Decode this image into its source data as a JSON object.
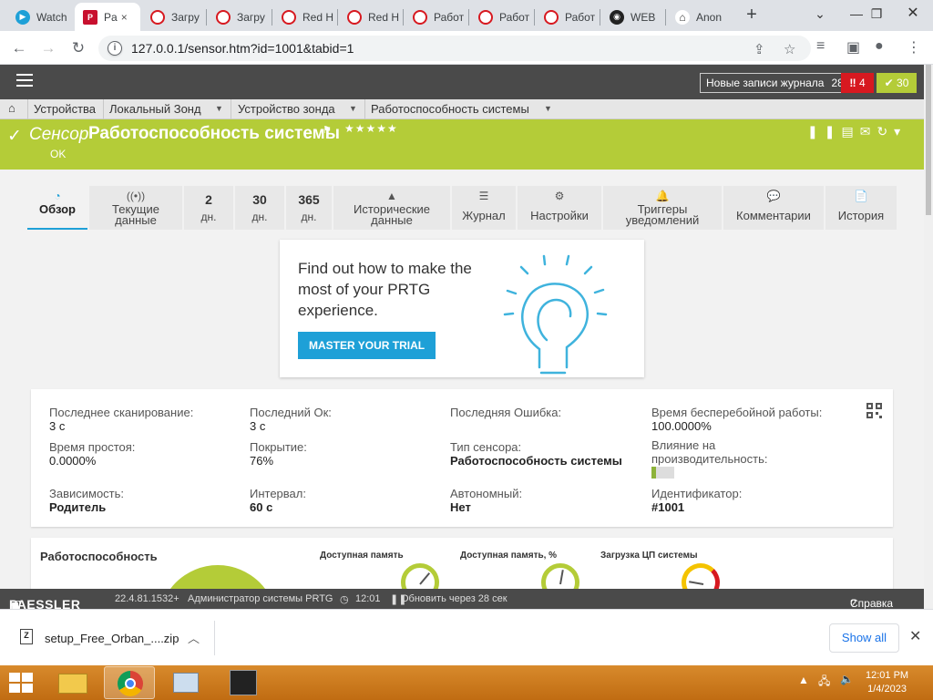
{
  "browser": {
    "tabs": [
      {
        "label": "Watch",
        "fav_color": "#1ea0d7",
        "active": false
      },
      {
        "label": "Pa",
        "fav_color": "#c8102e",
        "active": true
      },
      {
        "label": "Загру",
        "fav_color": "#d71920",
        "active": false
      },
      {
        "label": "Загру",
        "fav_color": "#d71920",
        "active": false
      },
      {
        "label": "Red H",
        "fav_color": "#d71920",
        "active": false
      },
      {
        "label": "Red H",
        "fav_color": "#d71920",
        "active": false
      },
      {
        "label": "Работ",
        "fav_color": "#d71920",
        "active": false
      },
      {
        "label": "Работ",
        "fav_color": "#d71920",
        "active": false
      },
      {
        "label": "Работ",
        "fav_color": "#d71920",
        "active": false
      },
      {
        "label": "WEB",
        "fav_color": "#222222",
        "active": false
      },
      {
        "label": "Anon",
        "fav_color": "#555555",
        "active": false
      }
    ],
    "active_tab_close": "×",
    "new_tab": "+",
    "url": "127.0.0.1/sensor.htm?id=1001&tabid=1"
  },
  "prtg": {
    "log_button": "Новые записи журнала",
    "log_count": "28",
    "alarms": "4",
    "ok_count": "30",
    "breadcrumb": [
      "Устройства",
      "Локальный Зонд",
      "Устройство зонда",
      "Работоспособность системы"
    ],
    "sensor": {
      "kind": "Сенсор",
      "name": "Работоспособность системы",
      "stars": "★★★★★",
      "status": "OK"
    },
    "tabs": [
      {
        "icon": "◔",
        "label": "Обзор",
        "active": true
      },
      {
        "icon": "((•))",
        "label": "Текущие данные"
      },
      {
        "n": "2",
        "d": "дн."
      },
      {
        "n": "30",
        "d": "дн."
      },
      {
        "n": "365",
        "d": "дн."
      },
      {
        "icon": "▲",
        "label": "Исторические данные"
      },
      {
        "icon": "☰",
        "label": "Журнал"
      },
      {
        "icon": "⚙",
        "label": "Настройки"
      },
      {
        "icon": "🔔",
        "label": "Триггеры уведомлений"
      },
      {
        "icon": "💬",
        "label": "Комментарии"
      },
      {
        "icon": "📄",
        "label": "История"
      }
    ],
    "promo": {
      "text": "Find out how to make the most of your PRTG experience.",
      "cta": "MASTER YOUR TRIAL"
    },
    "info": [
      {
        "k": "Последнее сканирование:",
        "v": "3 с"
      },
      {
        "k": "Последний Ок:",
        "v": "3 с"
      },
      {
        "k": "Последняя Ошибка:",
        "v": ""
      },
      {
        "k": "Время бесперебойной работы:",
        "v": "100.0000%"
      },
      {
        "k": "Время простоя:",
        "v": "0.0000%"
      },
      {
        "k": "Покрытие:",
        "v": "76%"
      },
      {
        "k": "Тип сенсора:",
        "v": "Работоспособность системы"
      },
      {
        "k": "Влияние на производительность:",
        "v": ""
      },
      {
        "k": "Зависимость:",
        "v": "Родитель"
      },
      {
        "k": "Интервал:",
        "v": "60 с"
      },
      {
        "k": "Автономный:",
        "v": "Нет"
      },
      {
        "k": "Идентификатор:",
        "v": "#1001"
      }
    ],
    "performance_impact_level": 1,
    "health_title": "Работоспособность",
    "gauges": [
      "Доступная память",
      "Доступная память, %",
      "Загрузка ЦП системы"
    ],
    "footer": {
      "logo": "PAESSLER",
      "version": "22.4.81.1532+",
      "user": "Администратор системы PRTG",
      "time": "12:01",
      "refresh": "Обновить через 28 сек",
      "help": "Справка"
    }
  },
  "downloads": {
    "file": "setup_Free_Orban_....zip",
    "show_all": "Show all"
  },
  "taskbar": {
    "time": "12:01 PM",
    "date": "1/4/2023"
  }
}
